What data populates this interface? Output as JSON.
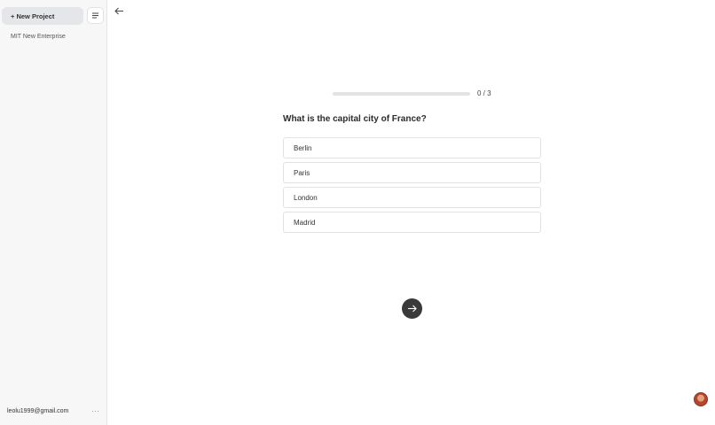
{
  "sidebar": {
    "new_project_label": "+ New Project",
    "projects": [
      {
        "label": "MIT New Enterprise"
      }
    ],
    "account": {
      "email": "leolu1999@gmail.com",
      "more_label": "···"
    }
  },
  "quiz": {
    "progress": {
      "current": 0,
      "total": 3,
      "text": "0 / 3"
    },
    "question": "What is the capital city of France?",
    "options": [
      {
        "label": "Berlin"
      },
      {
        "label": "Paris"
      },
      {
        "label": "London"
      },
      {
        "label": "Madrid"
      }
    ]
  },
  "icons": {
    "back": "arrow-left-icon",
    "filter": "lines-filter-icon",
    "next": "arrow-right-icon",
    "avatar": "user-avatar"
  },
  "colors": {
    "sidebar_bg": "#f7f7f7",
    "button_bg": "#e4e6e9",
    "next_button_bg": "#3a3a3a",
    "progress_track": "#e3e3e3"
  }
}
